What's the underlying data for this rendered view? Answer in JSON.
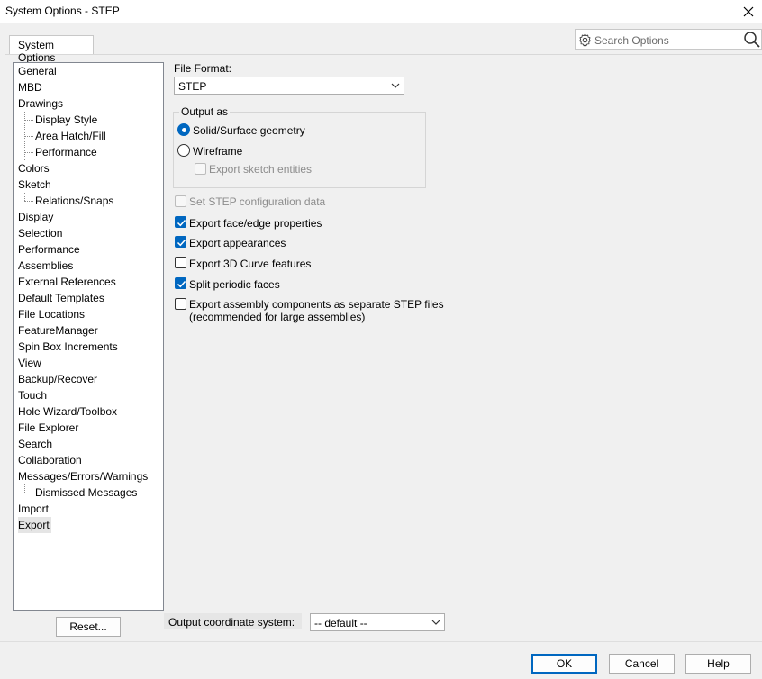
{
  "window": {
    "title": "System Options - STEP",
    "close_icon": "close-icon"
  },
  "tabs": [
    {
      "label": "System Options",
      "active": true
    }
  ],
  "search": {
    "placeholder": "Search Options",
    "icons": [
      "gear-icon",
      "search-icon"
    ]
  },
  "tree": {
    "items": [
      {
        "label": "General",
        "level": 0
      },
      {
        "label": "MBD",
        "level": 0
      },
      {
        "label": "Drawings",
        "level": 0
      },
      {
        "label": "Display Style",
        "level": 1
      },
      {
        "label": "Area Hatch/Fill",
        "level": 1
      },
      {
        "label": "Performance",
        "level": 1
      },
      {
        "label": "Colors",
        "level": 0
      },
      {
        "label": "Sketch",
        "level": 0
      },
      {
        "label": "Relations/Snaps",
        "level": 1
      },
      {
        "label": "Display",
        "level": 0
      },
      {
        "label": "Selection",
        "level": 0
      },
      {
        "label": "Performance",
        "level": 0
      },
      {
        "label": "Assemblies",
        "level": 0
      },
      {
        "label": "External References",
        "level": 0
      },
      {
        "label": "Default Templates",
        "level": 0
      },
      {
        "label": "File Locations",
        "level": 0
      },
      {
        "label": "FeatureManager",
        "level": 0
      },
      {
        "label": "Spin Box Increments",
        "level": 0
      },
      {
        "label": "View",
        "level": 0
      },
      {
        "label": "Backup/Recover",
        "level": 0
      },
      {
        "label": "Touch",
        "level": 0
      },
      {
        "label": "Hole Wizard/Toolbox",
        "level": 0
      },
      {
        "label": "File Explorer",
        "level": 0
      },
      {
        "label": "Search",
        "level": 0
      },
      {
        "label": "Collaboration",
        "level": 0
      },
      {
        "label": "Messages/Errors/Warnings",
        "level": 0
      },
      {
        "label": "Dismissed Messages",
        "level": 1
      },
      {
        "label": "Import",
        "level": 0
      },
      {
        "label": "Export",
        "level": 0,
        "selected": true
      }
    ]
  },
  "reset_label": "Reset...",
  "file_format": {
    "label": "File Format:",
    "value": "STEP"
  },
  "output_as": {
    "title": "Output as",
    "solid_label": "Solid/Surface geometry",
    "solid_checked": true,
    "wireframe_label": "Wireframe",
    "wireframe_checked": false,
    "sketch_label": "Export sketch entities",
    "sketch_checked": false
  },
  "options": {
    "step_config_label": "Set STEP configuration data",
    "face_edge_label": "Export face/edge properties",
    "appearances_label": "Export appearances",
    "curve3d_label": "Export 3D Curve features",
    "split_periodic_label": "Split periodic faces",
    "assembly_line1": "Export assembly components as separate STEP files",
    "assembly_line2": "(recommended for large assemblies)"
  },
  "coord_system": {
    "label": "Output coordinate system:",
    "value": "-- default --"
  },
  "footer": {
    "ok_label": "OK",
    "cancel_label": "Cancel",
    "help_label": "Help"
  },
  "colors": {
    "accent": "#0067c0",
    "selection": "#e5e5e5"
  }
}
